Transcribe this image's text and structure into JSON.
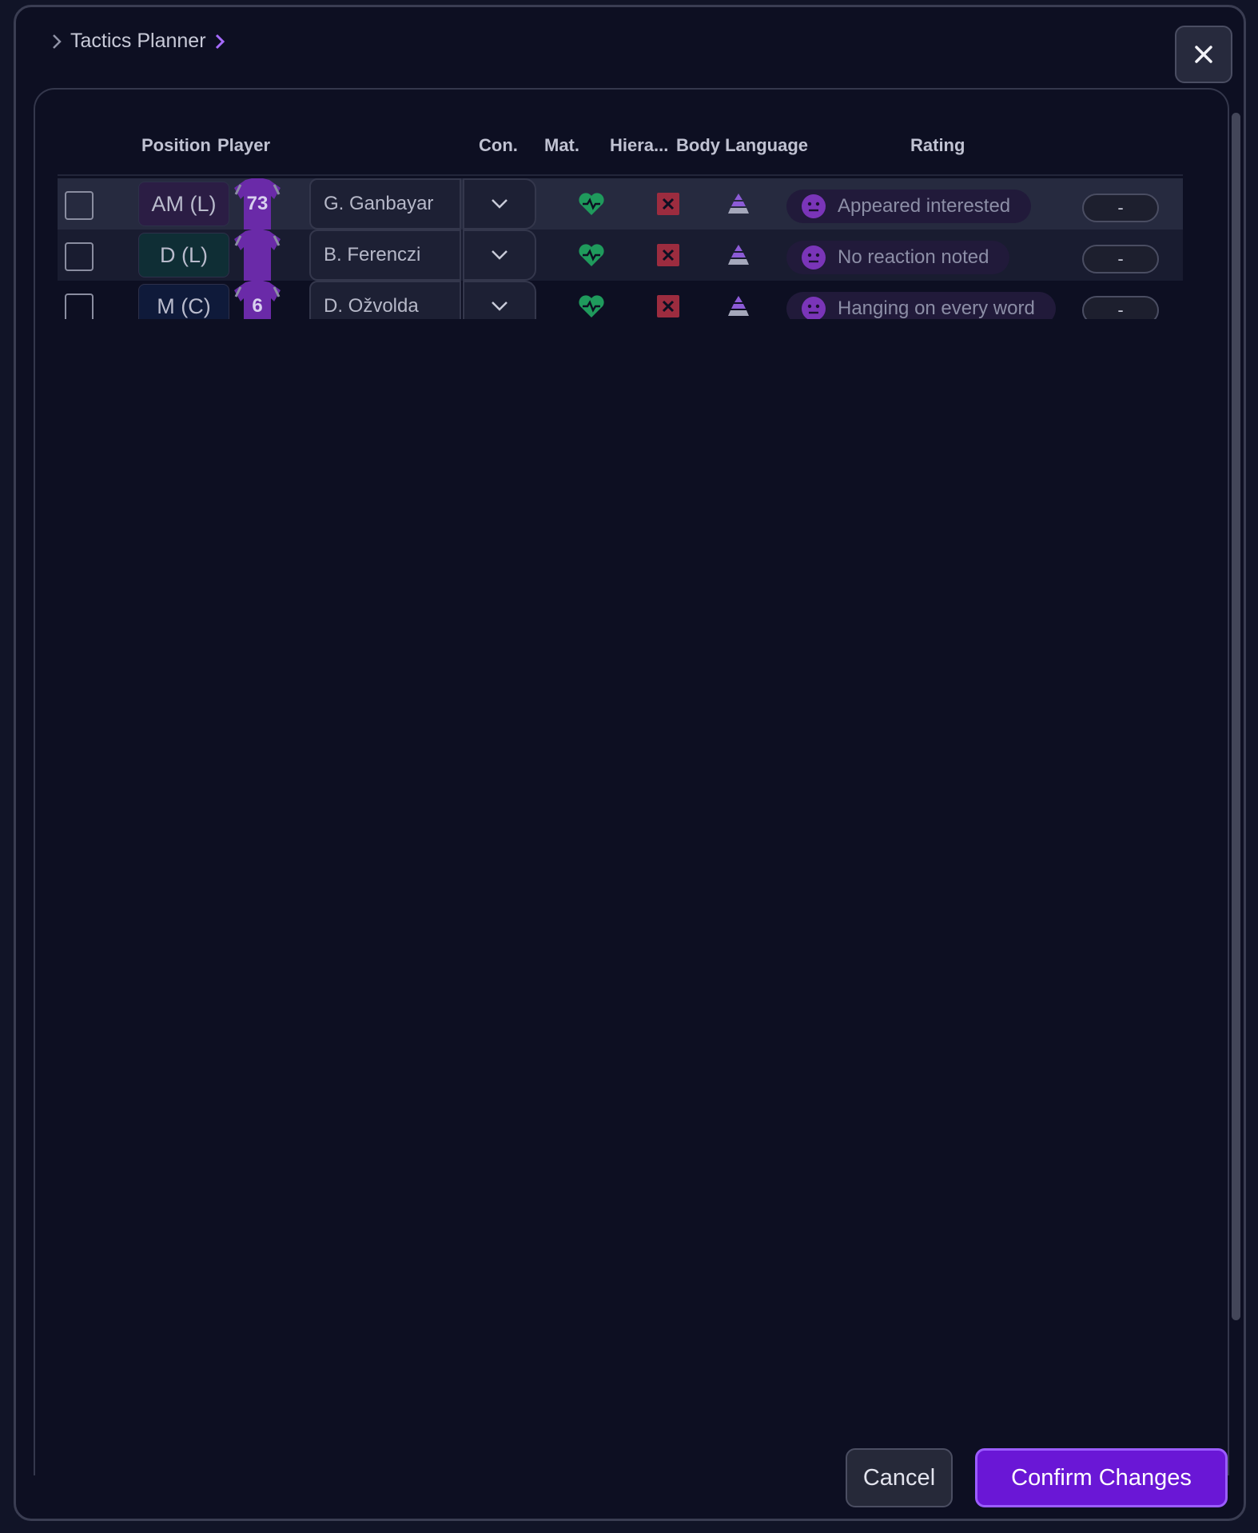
{
  "breadcrumb": {
    "title": "Tactics Planner"
  },
  "close": {
    "icon": "close-icon"
  },
  "columns": {
    "position": "Position",
    "player": "Player",
    "con": "Con.",
    "mat": "Mat.",
    "hier": "Hiera...",
    "body": "Body Language",
    "rating": "Rating"
  },
  "rows": [
    {
      "position": "AM (L)",
      "number": "73",
      "player": "G. Ganbayar",
      "body_language": "Appeared interested",
      "rating": "-"
    },
    {
      "position": "D (L)",
      "number": "",
      "player": "B. Ferenczi",
      "body_language": "No reaction noted",
      "rating": "-"
    },
    {
      "position": "M (C)",
      "number": "6",
      "player": "D. Ožvolda",
      "body_language": "Hanging on every word",
      "rating": "-"
    }
  ],
  "footer": {
    "cancel": "Cancel",
    "confirm": "Confirm Changes"
  },
  "colors": {
    "accent": "#6a17d6",
    "positive": "#1f9a5c",
    "negative": "#9c2c3f",
    "shirt": "#6a2aa8"
  }
}
